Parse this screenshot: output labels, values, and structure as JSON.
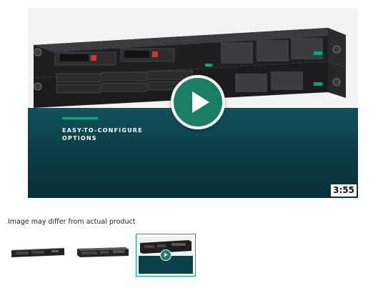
{
  "video": {
    "caption_line1": "EASY-TO-CONFIGURE",
    "caption_line2": "OPTIONS",
    "duration": "3:55",
    "accent_color": "#01a982",
    "panel_color": "#0c3e47"
  },
  "gallery": {
    "disclaimer": "Image may differ from actual product",
    "thumbnails": [
      {
        "kind": "image",
        "icon": "server-front-icon"
      },
      {
        "kind": "image",
        "icon": "server-angle-icon"
      },
      {
        "kind": "video",
        "icon": "play-icon",
        "selected": true
      }
    ]
  }
}
